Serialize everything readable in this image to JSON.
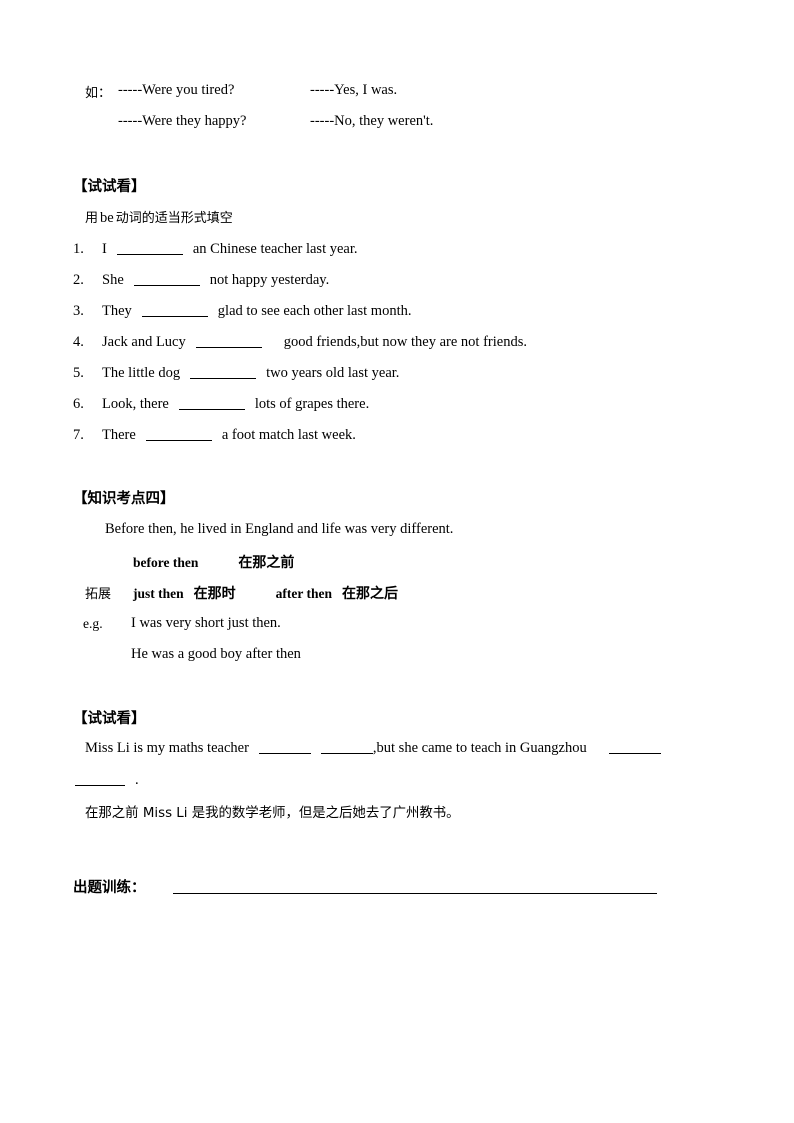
{
  "document": {
    "example_block": {
      "label": "如：",
      "rows": [
        {
          "question": "-----Were you tired?",
          "answer": "-----Yes, I was."
        },
        {
          "question": "-----Were they happy?",
          "answer": "-----No, they weren't."
        }
      ]
    },
    "try_it_section_1": {
      "heading": "【试试看】",
      "instruction_prefix": "用",
      "instruction_keyword": "be",
      "instruction_suffix": "动词的适当形式填空",
      "items": [
        {
          "number": "1.",
          "before": "I",
          "after": "an Chinese teacher last year."
        },
        {
          "number": "2.",
          "before": "She",
          "after": "not happy yesterday."
        },
        {
          "number": "3.",
          "before": "They",
          "after": "glad to see each other last month."
        },
        {
          "number": "4.",
          "before": "Jack and Lucy",
          "after": "good friends,but now they are not friends."
        },
        {
          "number": "5.",
          "before": "The little dog",
          "after": "two years old last year."
        },
        {
          "number": "6.",
          "before": "Look, there",
          "after": "lots of grapes there."
        },
        {
          "number": "7.",
          "before": "There",
          "after": "a foot match last week."
        }
      ]
    },
    "knowledge_point_4": {
      "heading": "【知识考点四】",
      "example_sentence": "Before then, he lived in England and life was very different.",
      "phrase_main": {
        "en": "before then",
        "cn": "在那之前"
      },
      "extend_label": "拓展",
      "phrases_extend": [
        {
          "en": "just then",
          "cn": "在那时"
        },
        {
          "en": "after then",
          "cn": "在那之后"
        }
      ],
      "eg_label": "e.g.",
      "eg_sentences": [
        "I was very short just then.",
        "He was a good boy after then"
      ]
    },
    "try_it_section_2": {
      "heading": "【试试看】",
      "sentence_part1": "Miss Li is my maths teacher",
      "sentence_part2": ",but she came to teach in Guangzhou",
      "sentence_end_punct": ".",
      "translation": "在那之前 Miss Li 是我的数学老师，但是之后她去了广州教书。"
    },
    "exercise_training": {
      "label": "出题训练："
    }
  }
}
